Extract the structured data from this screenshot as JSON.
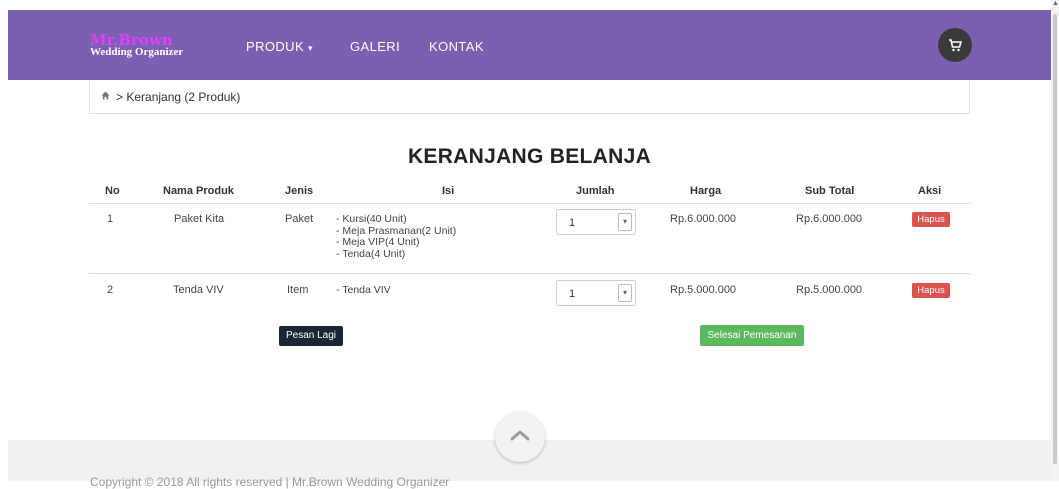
{
  "brand": {
    "name": "Mr.Brown",
    "tagline": "Wedding Organizer"
  },
  "nav": {
    "produk": "PRODUK",
    "galeri": "GALERI",
    "kontak": "KONTAK"
  },
  "icons": {
    "cart": "cart-icon",
    "home": "home-icon",
    "up": "chevron-up-icon"
  },
  "breadcrumb": {
    "text": "> Keranjang (2 Produk)"
  },
  "page_title": "KERANJANG BELANJA",
  "table": {
    "headers": {
      "no": "No",
      "nama": "Nama Produk",
      "jenis": "Jenis",
      "isi": "Isi",
      "jumlah": "Jumlah",
      "harga": "Harga",
      "subtotal": "Sub Total",
      "aksi": "Aksi"
    },
    "rows": [
      {
        "no": "1",
        "nama": "Paket Kita",
        "jenis": "Paket",
        "isi": [
          "- Kursi(40 Unit)",
          "- Meja Prasmanan(2 Unit)",
          "- Meja VIP(4 Unit)",
          "- Tenda(4 Unit)"
        ],
        "jumlah": "1",
        "harga": "Rp.6.000.000",
        "subtotal": "Rp.6.000.000",
        "aksi": "Hapus"
      },
      {
        "no": "2",
        "nama": "Tenda VIV",
        "jenis": "Item",
        "isi": [
          "- Tenda VIV"
        ],
        "jumlah": "1",
        "harga": "Rp.5.000.000",
        "subtotal": "Rp.5.000.000",
        "aksi": "Hapus"
      }
    ]
  },
  "buttons": {
    "pesan_lagi": "Pesan Lagi",
    "selesai": "Selesai Pemesanan"
  },
  "footer": {
    "text": "Copyright © 2018 All rights reserved | Mr.Brown Wedding Organizer"
  },
  "colors": {
    "navbar": "#7b5fb0",
    "hapus": "#d9534f",
    "selesai": "#5cb85c",
    "pesan_lagi": "#1a2633"
  }
}
